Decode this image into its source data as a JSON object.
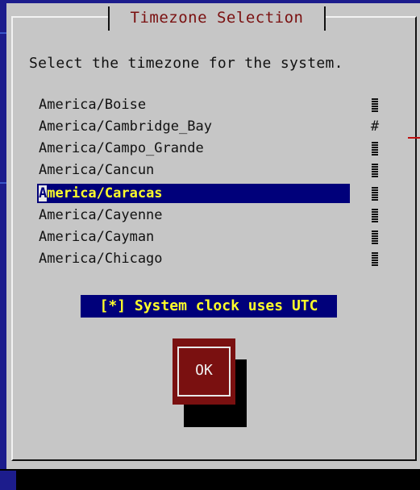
{
  "dialog": {
    "title": "Timezone Selection",
    "prompt": "Select the timezone for the system."
  },
  "timezones": {
    "items": [
      {
        "label": "America/Boise",
        "selected": false
      },
      {
        "label": "America/Cambridge_Bay",
        "selected": false
      },
      {
        "label": "America/Campo_Grande",
        "selected": false
      },
      {
        "label": "America/Cancun",
        "selected": false
      },
      {
        "label": "America/Caracas",
        "selected": true
      },
      {
        "label": "America/Cayenne",
        "selected": false
      },
      {
        "label": "America/Cayman",
        "selected": false
      },
      {
        "label": "America/Chicago",
        "selected": false
      }
    ],
    "selected_first_char": "A",
    "selected_rest": "merica/Caracas",
    "scroll_marker": "#"
  },
  "utc_checkbox": {
    "label": "[*] System clock uses UTC",
    "checked": true
  },
  "buttons": {
    "ok_label": "OK"
  },
  "colors": {
    "background": "#1c1c8c",
    "dialog": "#c6c6c6",
    "title_text": "#7a1010",
    "highlight_bg": "#00007a",
    "highlight_text": "#ffff2a",
    "button_bg": "#7a1010"
  }
}
